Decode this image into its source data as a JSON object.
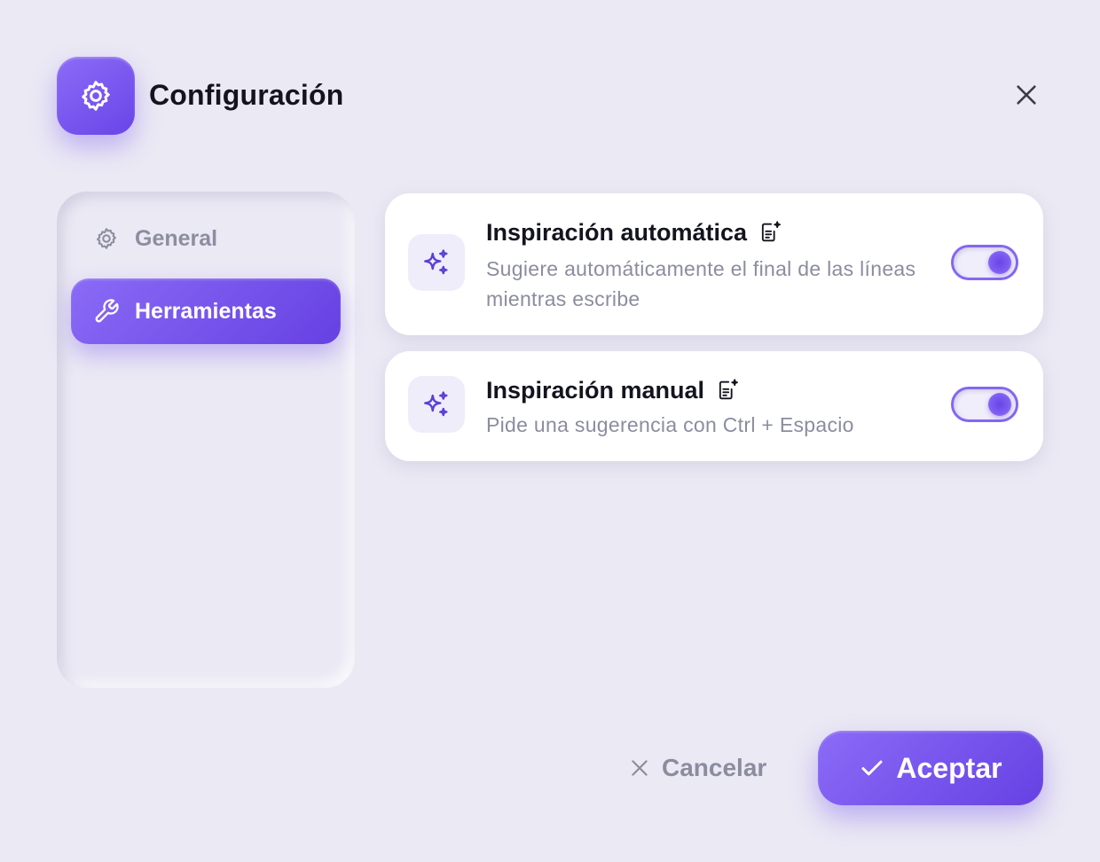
{
  "header": {
    "title": "Configuración",
    "icon": "gear-icon",
    "close_icon": "close-icon"
  },
  "sidebar": {
    "items": [
      {
        "label": "General",
        "icon": "gear-icon",
        "active": false
      },
      {
        "label": "Herramientas",
        "icon": "wrench-icon",
        "active": true
      }
    ]
  },
  "settings": [
    {
      "title": "Inspiración automática",
      "description": "Sugiere automáticamente el final de las líneas mientras escribe",
      "icon": "sparkles-icon",
      "badge_icon": "document-sparkle-icon",
      "enabled": true
    },
    {
      "title": "Inspiración manual",
      "description": "Pide una sugerencia con Ctrl + Espacio",
      "icon": "sparkles-icon",
      "badge_icon": "document-sparkle-icon",
      "enabled": true
    }
  ],
  "footer": {
    "cancel_label": "Cancelar",
    "accept_label": "Aceptar"
  },
  "colors": {
    "accent": "#7452ee",
    "background": "#ebe9f4",
    "muted_text": "#8b8d9f"
  }
}
